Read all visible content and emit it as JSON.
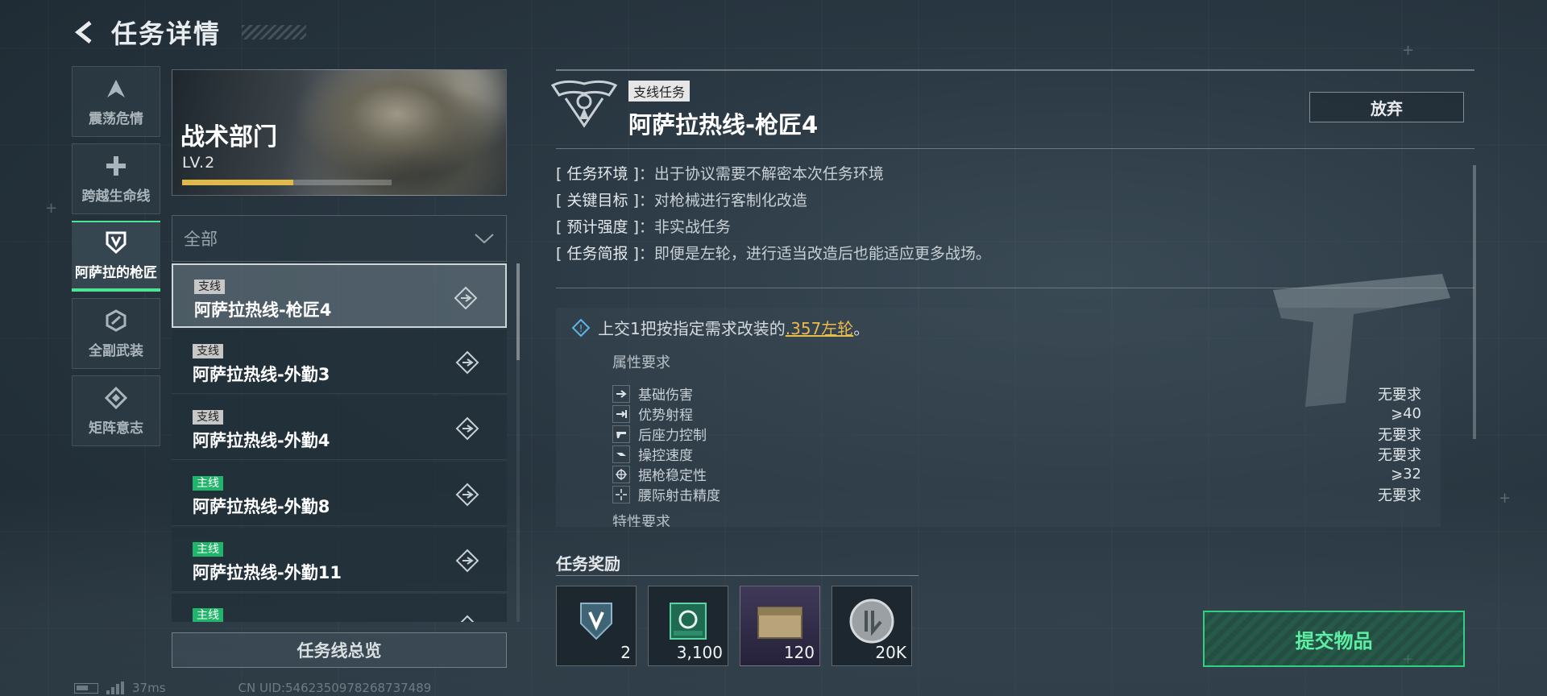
{
  "header": {
    "title": "任务详情"
  },
  "categories": [
    {
      "label": "震荡危情",
      "icon": "triangle-a-icon"
    },
    {
      "label": "跨越生命线",
      "icon": "plus-icon"
    },
    {
      "label": "阿萨拉的枪匠",
      "icon": "shield-v-icon",
      "active": true
    },
    {
      "label": "全副武装",
      "icon": "hexagon-icon"
    },
    {
      "label": "矩阵意志",
      "icon": "diamond-icon"
    }
  ],
  "department": {
    "name": "战术部门",
    "level": "LV.2",
    "progress": 0.53
  },
  "filter": {
    "value": "全部"
  },
  "missions": [
    {
      "badge": "支线",
      "type": "side",
      "name": "阿萨拉热线-枪匠4",
      "selected": true
    },
    {
      "badge": "支线",
      "type": "side",
      "name": "阿萨拉热线-外勤3"
    },
    {
      "badge": "支线",
      "type": "side",
      "name": "阿萨拉热线-外勤4"
    },
    {
      "badge": "主线",
      "type": "main",
      "name": "阿萨拉热线-外勤8"
    },
    {
      "badge": "主线",
      "type": "main",
      "name": "阿萨拉热线-外勤11"
    },
    {
      "badge": "主线",
      "type": "main",
      "name": ""
    }
  ],
  "overview_button": "任务线总览",
  "status": {
    "ping": "37ms",
    "uid": "CN UID:5462350978268737489"
  },
  "detail": {
    "type_badge": "支线任务",
    "title": "阿萨拉热线-枪匠4",
    "abandon_label": "放弃",
    "info": [
      {
        "key": "[ 任务环境 ]",
        "value": "出于协议需要不解密本次任务环境"
      },
      {
        "key": "[ 关键目标 ]",
        "value": "对枪械进行客制化改造"
      },
      {
        "key": "[ 预计强度 ]",
        "value": "非实战任务"
      },
      {
        "key": "[ 任务简报 ]",
        "value": "即便是左轮，进行适当改造后也能适应更多战场。"
      }
    ],
    "requirement": {
      "prefix": "上交1把按指定需求改装的",
      "highlight": ".357左轮",
      "suffix": "。",
      "attr_title": "属性要求",
      "attrs": [
        {
          "name": "基础伤害",
          "value": "无要求",
          "icon": "damage-icon"
        },
        {
          "name": "优势射程",
          "value": "⩾40",
          "icon": "range-icon"
        },
        {
          "name": "后座力控制",
          "value": "无要求",
          "icon": "recoil-icon"
        },
        {
          "name": "操控速度",
          "value": "无要求",
          "icon": "handling-icon"
        },
        {
          "name": "据枪稳定性",
          "value": "⩾32",
          "icon": "stability-icon"
        },
        {
          "name": "腰际射击精度",
          "value": "无要求",
          "icon": "hipfire-icon"
        }
      ],
      "trait_title": "特性要求"
    },
    "reward_title": "任务奖励",
    "rewards": [
      {
        "count": "2",
        "icon": "shield-badge-icon"
      },
      {
        "count": "3,100",
        "icon": "green-crate-icon"
      },
      {
        "count": "120",
        "icon": "ammo-box-icon"
      },
      {
        "count": "20K",
        "icon": "silver-coin-icon"
      }
    ],
    "submit_label": "提交物品"
  }
}
